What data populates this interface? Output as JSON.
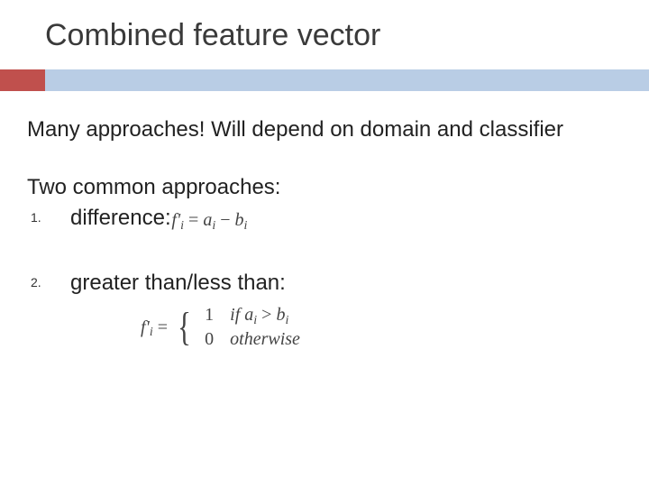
{
  "title": "Combined feature vector",
  "intro": "Many approaches!  Will depend on domain and classifier",
  "subhead": "Two common approaches:",
  "items": [
    {
      "num": "1.",
      "label": "difference:"
    },
    {
      "num": "2.",
      "label": "greater than/less than:"
    }
  ],
  "eq1": {
    "lhs_text": "f'",
    "sub": "i",
    "eq_sign": " = ",
    "rhs_a": "a",
    "rhs_a_sub": "i",
    "minus": " − ",
    "rhs_b": "b",
    "rhs_b_sub": "i"
  },
  "eq2": {
    "lhs_text": "f'",
    "sub": "i",
    "eq_sign": " = ",
    "case1_val": "1",
    "case1_cond_if": "if ",
    "case1_a": "a",
    "case1_a_sub": "i",
    "case1_gt": " > ",
    "case1_b": "b",
    "case1_b_sub": "i",
    "case2_val": "0",
    "case2_cond": "otherwise"
  }
}
